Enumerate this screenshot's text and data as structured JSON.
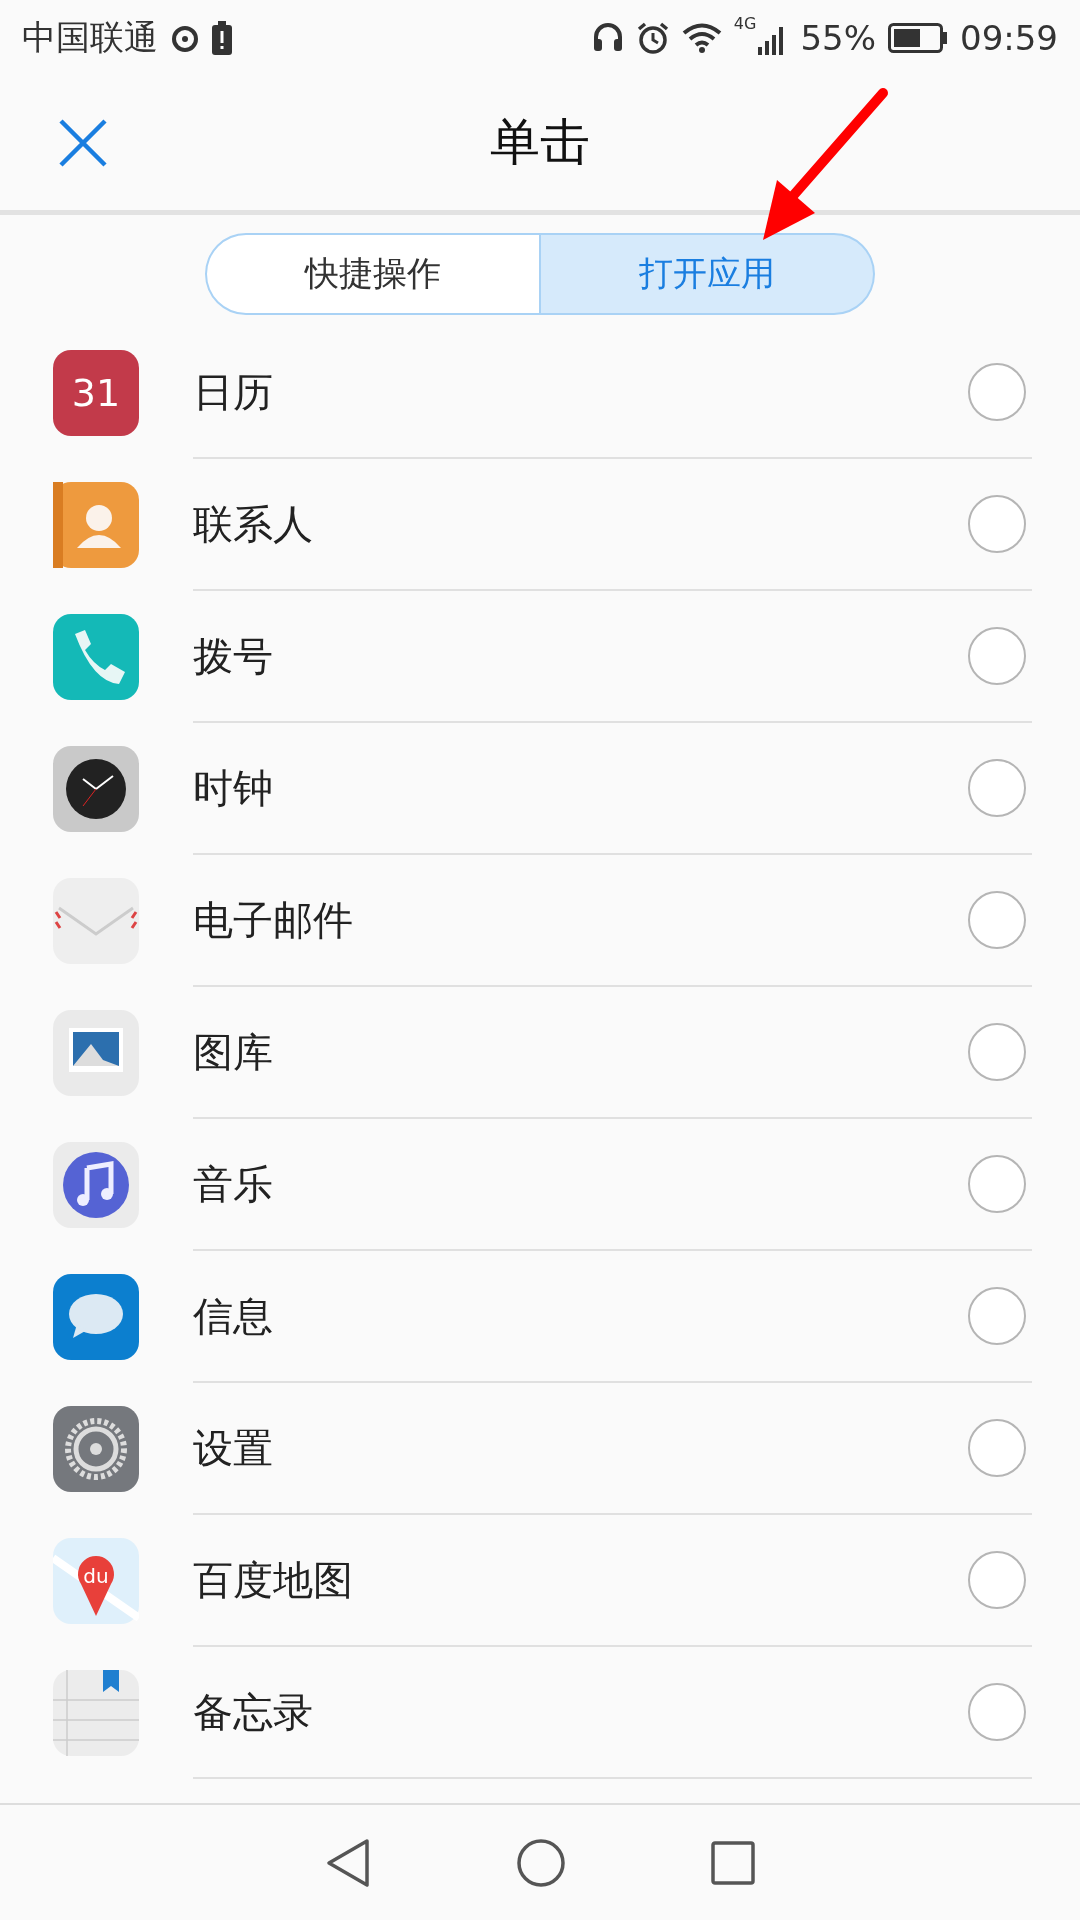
{
  "status_bar": {
    "carrier": "中国联通",
    "battery": "55%",
    "time": "09:59",
    "network": "4G"
  },
  "header": {
    "title": "单击"
  },
  "tabs": [
    {
      "label": "快捷操作",
      "selected": false
    },
    {
      "label": "打开应用",
      "selected": true
    }
  ],
  "apps": [
    {
      "name": "日历",
      "kind": "calendar",
      "icon_text": "31",
      "selected": false
    },
    {
      "name": "联系人",
      "kind": "contacts",
      "selected": false
    },
    {
      "name": "拨号",
      "kind": "phone",
      "selected": false
    },
    {
      "name": "时钟",
      "kind": "clock",
      "selected": false
    },
    {
      "name": "电子邮件",
      "kind": "mail",
      "selected": false
    },
    {
      "name": "图库",
      "kind": "gallery",
      "selected": false
    },
    {
      "name": "音乐",
      "kind": "music",
      "selected": false
    },
    {
      "name": "信息",
      "kind": "messages",
      "selected": false
    },
    {
      "name": "设置",
      "kind": "settings",
      "selected": false
    },
    {
      "name": "百度地图",
      "kind": "map",
      "icon_text": "du",
      "selected": false
    },
    {
      "name": "备忘录",
      "kind": "notes",
      "selected": false
    }
  ]
}
